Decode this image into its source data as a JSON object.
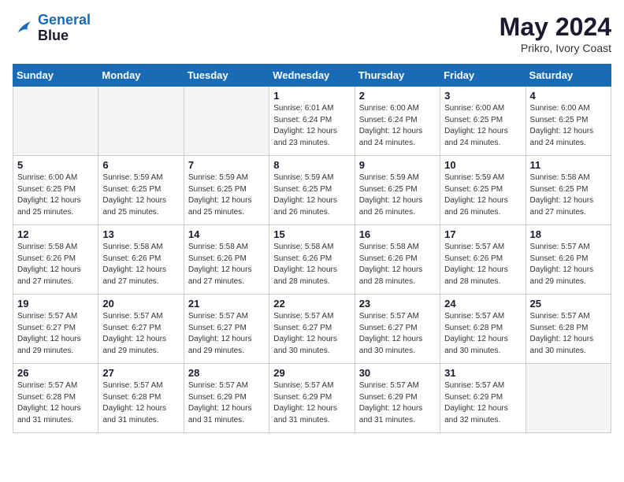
{
  "header": {
    "logo_line1": "General",
    "logo_line2": "Blue",
    "month": "May 2024",
    "location": "Prikro, Ivory Coast"
  },
  "weekdays": [
    "Sunday",
    "Monday",
    "Tuesday",
    "Wednesday",
    "Thursday",
    "Friday",
    "Saturday"
  ],
  "weeks": [
    [
      {
        "day": "",
        "info": ""
      },
      {
        "day": "",
        "info": ""
      },
      {
        "day": "",
        "info": ""
      },
      {
        "day": "1",
        "info": "Sunrise: 6:01 AM\nSunset: 6:24 PM\nDaylight: 12 hours\nand 23 minutes."
      },
      {
        "day": "2",
        "info": "Sunrise: 6:00 AM\nSunset: 6:24 PM\nDaylight: 12 hours\nand 24 minutes."
      },
      {
        "day": "3",
        "info": "Sunrise: 6:00 AM\nSunset: 6:25 PM\nDaylight: 12 hours\nand 24 minutes."
      },
      {
        "day": "4",
        "info": "Sunrise: 6:00 AM\nSunset: 6:25 PM\nDaylight: 12 hours\nand 24 minutes."
      }
    ],
    [
      {
        "day": "5",
        "info": "Sunrise: 6:00 AM\nSunset: 6:25 PM\nDaylight: 12 hours\nand 25 minutes."
      },
      {
        "day": "6",
        "info": "Sunrise: 5:59 AM\nSunset: 6:25 PM\nDaylight: 12 hours\nand 25 minutes."
      },
      {
        "day": "7",
        "info": "Sunrise: 5:59 AM\nSunset: 6:25 PM\nDaylight: 12 hours\nand 25 minutes."
      },
      {
        "day": "8",
        "info": "Sunrise: 5:59 AM\nSunset: 6:25 PM\nDaylight: 12 hours\nand 26 minutes."
      },
      {
        "day": "9",
        "info": "Sunrise: 5:59 AM\nSunset: 6:25 PM\nDaylight: 12 hours\nand 26 minutes."
      },
      {
        "day": "10",
        "info": "Sunrise: 5:59 AM\nSunset: 6:25 PM\nDaylight: 12 hours\nand 26 minutes."
      },
      {
        "day": "11",
        "info": "Sunrise: 5:58 AM\nSunset: 6:25 PM\nDaylight: 12 hours\nand 27 minutes."
      }
    ],
    [
      {
        "day": "12",
        "info": "Sunrise: 5:58 AM\nSunset: 6:26 PM\nDaylight: 12 hours\nand 27 minutes."
      },
      {
        "day": "13",
        "info": "Sunrise: 5:58 AM\nSunset: 6:26 PM\nDaylight: 12 hours\nand 27 minutes."
      },
      {
        "day": "14",
        "info": "Sunrise: 5:58 AM\nSunset: 6:26 PM\nDaylight: 12 hours\nand 27 minutes."
      },
      {
        "day": "15",
        "info": "Sunrise: 5:58 AM\nSunset: 6:26 PM\nDaylight: 12 hours\nand 28 minutes."
      },
      {
        "day": "16",
        "info": "Sunrise: 5:58 AM\nSunset: 6:26 PM\nDaylight: 12 hours\nand 28 minutes."
      },
      {
        "day": "17",
        "info": "Sunrise: 5:57 AM\nSunset: 6:26 PM\nDaylight: 12 hours\nand 28 minutes."
      },
      {
        "day": "18",
        "info": "Sunrise: 5:57 AM\nSunset: 6:26 PM\nDaylight: 12 hours\nand 29 minutes."
      }
    ],
    [
      {
        "day": "19",
        "info": "Sunrise: 5:57 AM\nSunset: 6:27 PM\nDaylight: 12 hours\nand 29 minutes."
      },
      {
        "day": "20",
        "info": "Sunrise: 5:57 AM\nSunset: 6:27 PM\nDaylight: 12 hours\nand 29 minutes."
      },
      {
        "day": "21",
        "info": "Sunrise: 5:57 AM\nSunset: 6:27 PM\nDaylight: 12 hours\nand 29 minutes."
      },
      {
        "day": "22",
        "info": "Sunrise: 5:57 AM\nSunset: 6:27 PM\nDaylight: 12 hours\nand 30 minutes."
      },
      {
        "day": "23",
        "info": "Sunrise: 5:57 AM\nSunset: 6:27 PM\nDaylight: 12 hours\nand 30 minutes."
      },
      {
        "day": "24",
        "info": "Sunrise: 5:57 AM\nSunset: 6:28 PM\nDaylight: 12 hours\nand 30 minutes."
      },
      {
        "day": "25",
        "info": "Sunrise: 5:57 AM\nSunset: 6:28 PM\nDaylight: 12 hours\nand 30 minutes."
      }
    ],
    [
      {
        "day": "26",
        "info": "Sunrise: 5:57 AM\nSunset: 6:28 PM\nDaylight: 12 hours\nand 31 minutes."
      },
      {
        "day": "27",
        "info": "Sunrise: 5:57 AM\nSunset: 6:28 PM\nDaylight: 12 hours\nand 31 minutes."
      },
      {
        "day": "28",
        "info": "Sunrise: 5:57 AM\nSunset: 6:29 PM\nDaylight: 12 hours\nand 31 minutes."
      },
      {
        "day": "29",
        "info": "Sunrise: 5:57 AM\nSunset: 6:29 PM\nDaylight: 12 hours\nand 31 minutes."
      },
      {
        "day": "30",
        "info": "Sunrise: 5:57 AM\nSunset: 6:29 PM\nDaylight: 12 hours\nand 31 minutes."
      },
      {
        "day": "31",
        "info": "Sunrise: 5:57 AM\nSunset: 6:29 PM\nDaylight: 12 hours\nand 32 minutes."
      },
      {
        "day": "",
        "info": ""
      }
    ]
  ]
}
